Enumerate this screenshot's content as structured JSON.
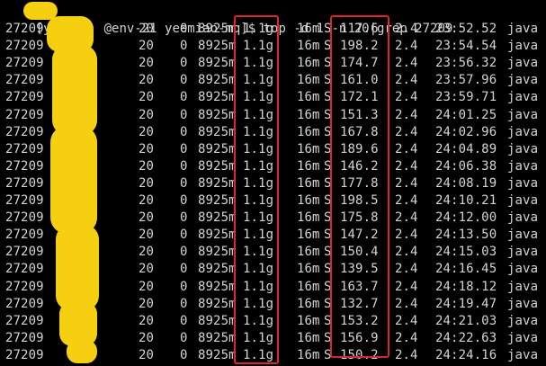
{
  "command": {
    "prompt_start": "[y",
    "prompt_host": "@env-21 yeemiao-mq]$ ",
    "command_text": "top -d 1 -n 20|grep 27209"
  },
  "rows": [
    {
      "pid": "27209",
      "pr": "20",
      "ni": "0",
      "virt": "8925m",
      "res": "1.1g",
      "shr": "16m",
      "s": "S",
      "cpu": "117.6",
      "mem": "2.4",
      "time": "23:52.52",
      "command": "java"
    },
    {
      "pid": "27209",
      "pr": "20",
      "ni": "0",
      "virt": "8925m",
      "res": "1.1g",
      "shr": "16m",
      "s": "S",
      "cpu": "198.2",
      "mem": "2.4",
      "time": "23:54.54",
      "command": "java"
    },
    {
      "pid": "27209",
      "pr": "20",
      "ni": "0",
      "virt": "8925m",
      "res": "1.1g",
      "shr": "16m",
      "s": "S",
      "cpu": "174.7",
      "mem": "2.4",
      "time": "23:56.32",
      "command": "java"
    },
    {
      "pid": "27209",
      "pr": "20",
      "ni": "0",
      "virt": "8925m",
      "res": "1.1g",
      "shr": "16m",
      "s": "S",
      "cpu": "161.0",
      "mem": "2.4",
      "time": "23:57.96",
      "command": "java"
    },
    {
      "pid": "27209",
      "pr": "20",
      "ni": "0",
      "virt": "8925m",
      "res": "1.1g",
      "shr": "16m",
      "s": "S",
      "cpu": "172.1",
      "mem": "2.4",
      "time": "23:59.71",
      "command": "java"
    },
    {
      "pid": "27209",
      "pr": "20",
      "ni": "0",
      "virt": "8925m",
      "res": "1.1g",
      "shr": "16m",
      "s": "S",
      "cpu": "151.3",
      "mem": "2.4",
      "time": "24:01.25",
      "command": "java"
    },
    {
      "pid": "27209",
      "pr": "20",
      "ni": "0",
      "virt": "8925m",
      "res": "1.1g",
      "shr": "16m",
      "s": "S",
      "cpu": "167.8",
      "mem": "2.4",
      "time": "24:02.96",
      "command": "java"
    },
    {
      "pid": "27209",
      "pr": "20",
      "ni": "0",
      "virt": "8925m",
      "res": "1.1g",
      "shr": "16m",
      "s": "S",
      "cpu": "189.6",
      "mem": "2.4",
      "time": "24:04.89",
      "command": "java"
    },
    {
      "pid": "27209",
      "pr": "20",
      "ni": "0",
      "virt": "8925m",
      "res": "1.1g",
      "shr": "16m",
      "s": "S",
      "cpu": "146.2",
      "mem": "2.4",
      "time": "24:06.38",
      "command": "java"
    },
    {
      "pid": "27209",
      "pr": "20",
      "ni": "0",
      "virt": "8925m",
      "res": "1.1g",
      "shr": "16m",
      "s": "S",
      "cpu": "177.8",
      "mem": "2.4",
      "time": "24:08.19",
      "command": "java"
    },
    {
      "pid": "27209",
      "pr": "20",
      "ni": "0",
      "virt": "8925m",
      "res": "1.1g",
      "shr": "16m",
      "s": "S",
      "cpu": "198.5",
      "mem": "2.4",
      "time": "24:10.21",
      "command": "java"
    },
    {
      "pid": "27209",
      "pr": "20",
      "ni": "0",
      "virt": "8925m",
      "res": "1.1g",
      "shr": "16m",
      "s": "S",
      "cpu": "175.8",
      "mem": "2.4",
      "time": "24:12.00",
      "command": "java"
    },
    {
      "pid": "27209",
      "pr": "20",
      "ni": "0",
      "virt": "8925m",
      "res": "1.1g",
      "shr": "16m",
      "s": "S",
      "cpu": "147.2",
      "mem": "2.4",
      "time": "24:13.50",
      "command": "java"
    },
    {
      "pid": "27209",
      "pr": "20",
      "ni": "0",
      "virt": "8925m",
      "res": "1.1g",
      "shr": "16m",
      "s": "S",
      "cpu": "150.4",
      "mem": "2.4",
      "time": "24:15.03",
      "command": "java"
    },
    {
      "pid": "27209",
      "pr": "20",
      "ni": "0",
      "virt": "8925m",
      "res": "1.1g",
      "shr": "16m",
      "s": "S",
      "cpu": "139.5",
      "mem": "2.4",
      "time": "24:16.45",
      "command": "java"
    },
    {
      "pid": "27209",
      "pr": "20",
      "ni": "0",
      "virt": "8925m",
      "res": "1.1g",
      "shr": "16m",
      "s": "S",
      "cpu": "163.7",
      "mem": "2.4",
      "time": "24:18.12",
      "command": "java"
    },
    {
      "pid": "27209",
      "pr": "20",
      "ni": "0",
      "virt": "8925m",
      "res": "1.1g",
      "shr": "16m",
      "s": "S",
      "cpu": "132.7",
      "mem": "2.4",
      "time": "24:19.47",
      "command": "java"
    },
    {
      "pid": "27209",
      "pr": "20",
      "ni": "0",
      "virt": "8925m",
      "res": "1.1g",
      "shr": "16m",
      "s": "S",
      "cpu": "153.2",
      "mem": "2.4",
      "time": "24:21.03",
      "command": "java"
    },
    {
      "pid": "27209",
      "pr": "20",
      "ni": "0",
      "virt": "8925m",
      "res": "1.1g",
      "shr": "16m",
      "s": "S",
      "cpu": "156.9",
      "mem": "2.4",
      "time": "24:22.63",
      "command": "java"
    },
    {
      "pid": "27209",
      "pr": "20",
      "ni": "0",
      "virt": "8925m",
      "res": "1.1g",
      "shr": "16m",
      "s": "S",
      "cpu": "150.2",
      "mem": "2.4",
      "time": "24:24.16",
      "command": "java"
    }
  ],
  "colors": {
    "background": "#000000",
    "text": "#d4d4d4",
    "highlight": "#e0262c",
    "redaction": "#f5cf10"
  }
}
